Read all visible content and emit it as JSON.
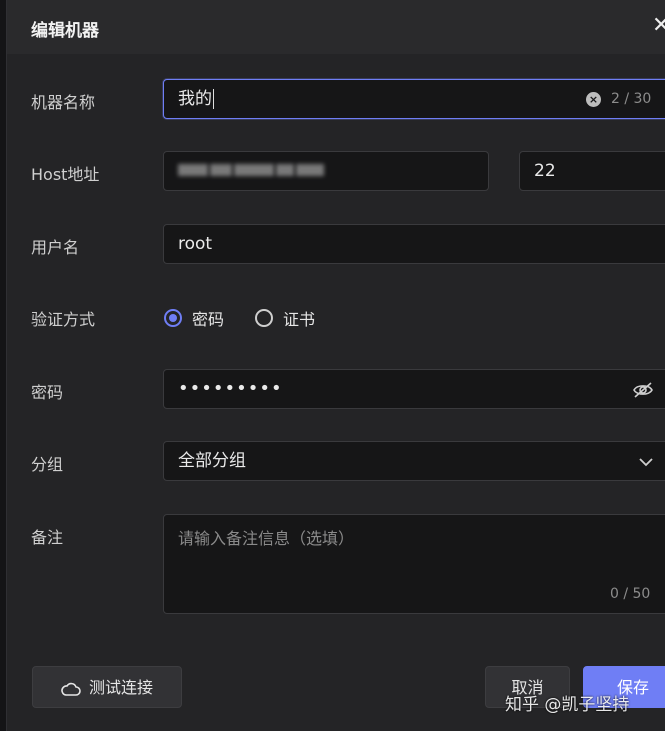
{
  "dialog": {
    "title": "编辑机器",
    "close_glyph": "✕"
  },
  "form": {
    "name": {
      "label": "机器名称",
      "value": "我的",
      "counter": "2 / 30"
    },
    "host": {
      "label": "Host地址",
      "port_value": "22"
    },
    "user": {
      "label": "用户名",
      "value": "root"
    },
    "auth": {
      "label": "验证方式",
      "options": [
        "密码",
        "证书"
      ],
      "selected": "密码"
    },
    "password": {
      "label": "密码",
      "value": "•••••••••"
    },
    "group": {
      "label": "分组",
      "value": "全部分组"
    },
    "remark": {
      "label": "备注",
      "placeholder": "请输入备注信息（选填）",
      "counter": "0 / 50"
    }
  },
  "footer": {
    "test_label": "测试连接",
    "cancel_label": "取消",
    "save_label": "保存"
  },
  "watermark": "知乎 @凯子坚持",
  "colors": {
    "accent": "#6f7ef5",
    "panel": "#242426",
    "input_bg": "#161617"
  },
  "icons": [
    "close-icon",
    "clear-icon",
    "eye-off-icon",
    "chevron-down-icon",
    "cloud-icon"
  ]
}
